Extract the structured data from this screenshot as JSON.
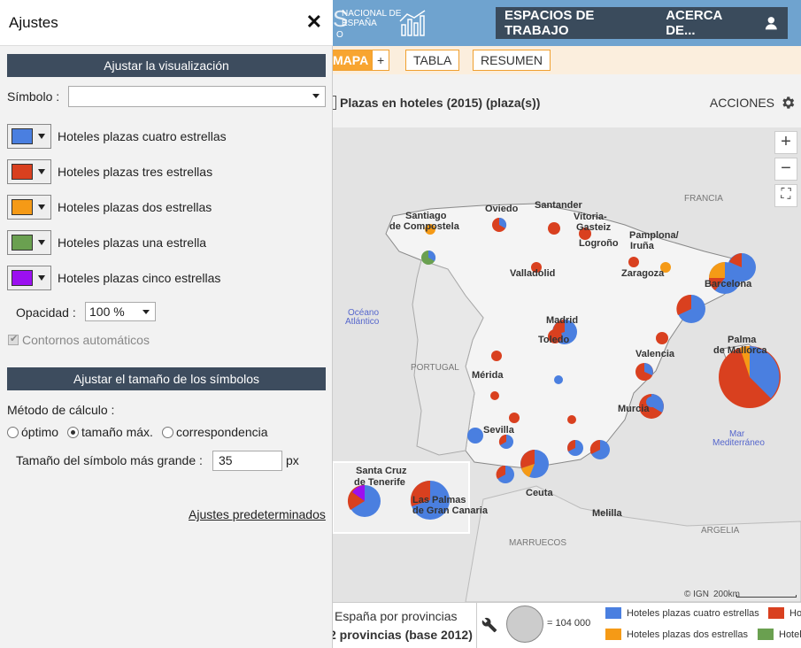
{
  "app": {
    "logo_line1": "NACIONAL DE ESPAÑA",
    "nav": [
      "ESPACIOS DE TRABAJO",
      "ACERCA DE..."
    ],
    "tabs": [
      {
        "label": "MAPA",
        "active": true
      },
      {
        "label": "+",
        "active": false
      },
      {
        "label": "TABLA",
        "active": false
      },
      {
        "label": "RESUMEN",
        "active": false
      }
    ],
    "map_title": "Plazas en hoteles (2015) (plaza(s))",
    "actions_label": "ACCIONES"
  },
  "map": {
    "controls": [
      "+",
      "−",
      "⛶"
    ],
    "labels": [
      {
        "text": "Santiago"
      },
      {
        "text": "de Compostela"
      },
      {
        "text": "Oviedo"
      },
      {
        "text": "Santander"
      },
      {
        "text": "Vitoria-"
      },
      {
        "text": "Gasteiz"
      },
      {
        "text": "Logroño"
      },
      {
        "text": "Pamplona/"
      },
      {
        "text": "Iruña"
      },
      {
        "text": "Valladolid"
      },
      {
        "text": "Zaragoza"
      },
      {
        "text": "Barcelona"
      },
      {
        "text": "Madrid"
      },
      {
        "text": "Toledo"
      },
      {
        "text": "Palma"
      },
      {
        "text": "de Mallorca"
      },
      {
        "text": "Valencia"
      },
      {
        "text": "Mérida"
      },
      {
        "text": "Murcia"
      },
      {
        "text": "Sevilla"
      },
      {
        "text": "Santa Cruz"
      },
      {
        "text": "de Tenerife"
      },
      {
        "text": "Las Palmas"
      },
      {
        "text": "de Gran Canaria"
      },
      {
        "text": "Ceuta"
      },
      {
        "text": "Melilla"
      }
    ],
    "region_labels": [
      "FRANCIA",
      "Océano",
      "Atlántico",
      "PORTUGAL",
      "Mar",
      "Mediterráneo",
      "MARRUECOS",
      "ARGELIA"
    ],
    "attribution": "© IGN",
    "scale": "200km"
  },
  "footer": {
    "line1": "España por provincias",
    "line2": "2 provincias (base 2012)",
    "scale_value": "= 104 000",
    "legend": [
      {
        "label": "Hoteles plazas cuatro estrellas",
        "color": "#4a7fe0"
      },
      {
        "label": "Ho",
        "color": "#d9401f"
      },
      {
        "label": "Hoteles plazas dos estrellas",
        "color": "#f59a16"
      },
      {
        "label": "Hotel",
        "color": "#6aa050"
      }
    ]
  },
  "panel": {
    "title": "Ajustes",
    "close": "✕",
    "section1": "Ajustar la visualización",
    "symbol_label": "Símbolo :",
    "symbol_value": "",
    "series": [
      {
        "label": "Hoteles plazas cuatro estrellas",
        "color": "#4a7fe0"
      },
      {
        "label": "Hoteles plazas tres estrellas",
        "color": "#d9401f"
      },
      {
        "label": "Hoteles plazas dos estrellas",
        "color": "#f59a16"
      },
      {
        "label": "Hoteles plazas una estrella",
        "color": "#6aa050"
      },
      {
        "label": "Hoteles plazas cinco estrellas",
        "color": "#9b10f0"
      }
    ],
    "opacity_label": "Opacidad :",
    "opacity_value": "100 %",
    "auto_outline_label": "Contornos automáticos",
    "section2": "Ajustar el tamaño de los símbolos",
    "method_label": "Método de cálculo :",
    "methods": [
      {
        "label": "óptimo",
        "selected": false
      },
      {
        "label": "tamaño máx.",
        "selected": true
      },
      {
        "label": "correspondencia",
        "selected": false
      }
    ],
    "max_size_label": "Tamaño del símbolo más grande :",
    "max_size_value": "35",
    "max_size_unit": "px",
    "defaults_link": "Ajustes predeterminados"
  }
}
